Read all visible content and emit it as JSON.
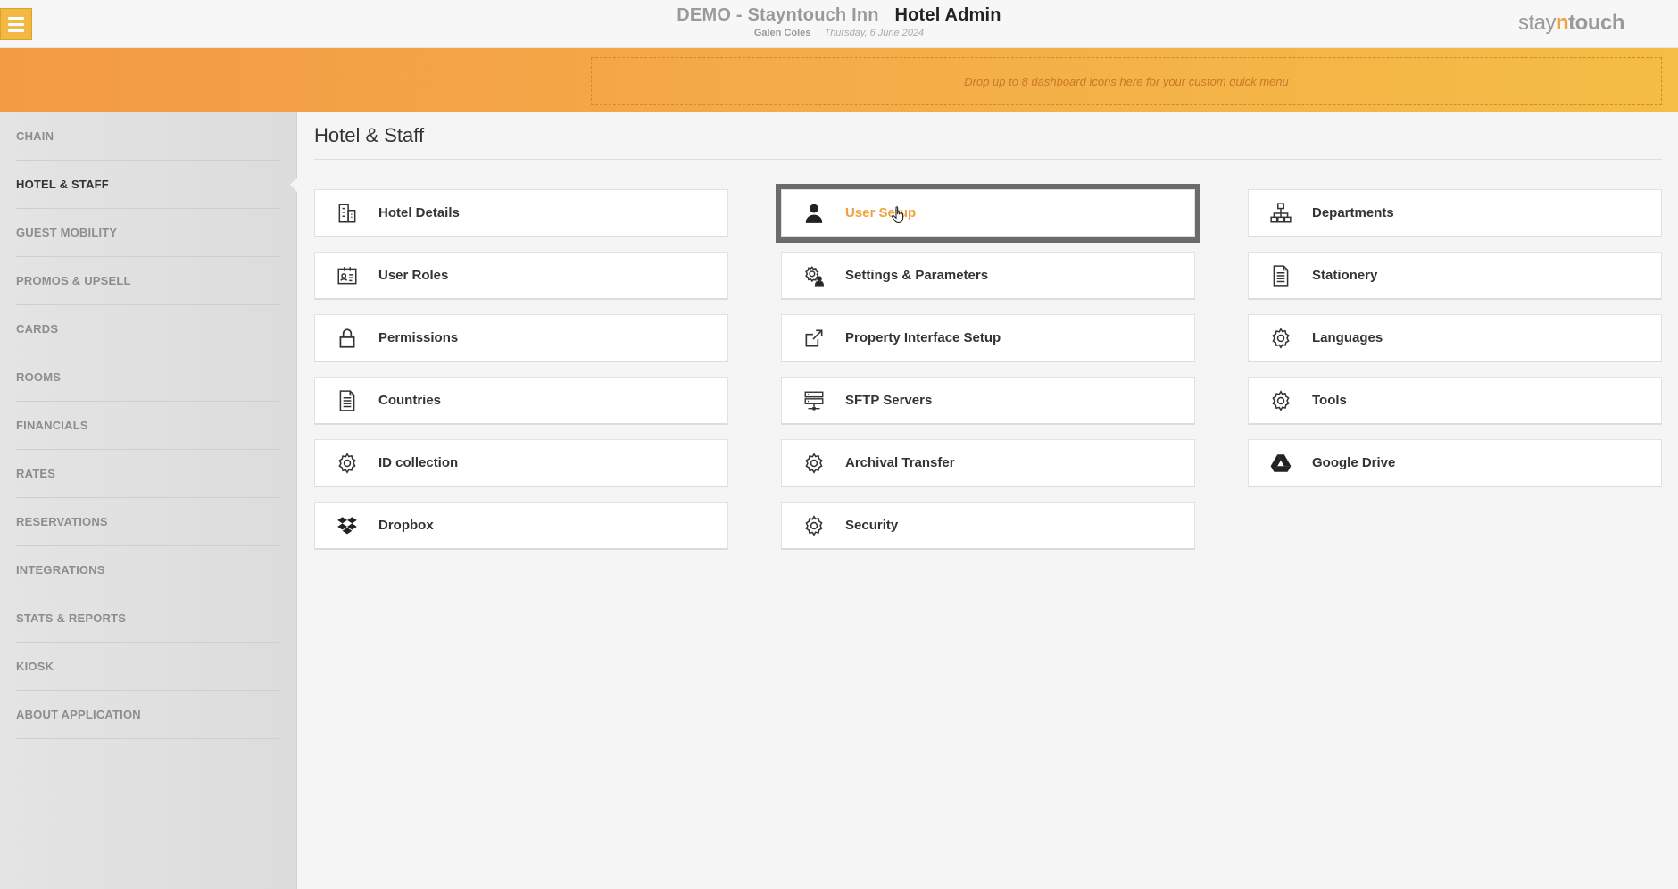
{
  "header": {
    "hotel_name": "DEMO - Stayntouch Inn",
    "app_title": "Hotel Admin",
    "user_name": "Galen Coles",
    "date": "Thursday, 6 June 2024",
    "brand_stay": "stay",
    "brand_n": "n",
    "brand_touch": "touch"
  },
  "quick_menu": {
    "placeholder": "Drop up to 8 dashboard icons here for your custom quick menu"
  },
  "sidebar": {
    "items": [
      {
        "label": "CHAIN"
      },
      {
        "label": "HOTEL & STAFF"
      },
      {
        "label": "GUEST MOBILITY"
      },
      {
        "label": "PROMOS & UPSELL"
      },
      {
        "label": "CARDS"
      },
      {
        "label": "ROOMS"
      },
      {
        "label": "FINANCIALS"
      },
      {
        "label": "RATES"
      },
      {
        "label": "RESERVATIONS"
      },
      {
        "label": "INTEGRATIONS"
      },
      {
        "label": "STATS & REPORTS"
      },
      {
        "label": "KIOSK"
      },
      {
        "label": "ABOUT APPLICATION"
      }
    ],
    "active": "HOTEL & STAFF"
  },
  "main": {
    "title": "Hotel & Staff",
    "tiles": [
      {
        "label": "Hotel Details",
        "icon": "building-icon"
      },
      {
        "label": "User Setup",
        "icon": "user-icon"
      },
      {
        "label": "Departments",
        "icon": "org-chart-icon"
      },
      {
        "label": "User Roles",
        "icon": "id-card-icon"
      },
      {
        "label": "Settings & Parameters",
        "icon": "user-gear-icon"
      },
      {
        "label": "Stationery",
        "icon": "document-icon"
      },
      {
        "label": "Permissions",
        "icon": "lock-icon"
      },
      {
        "label": "Property Interface Setup",
        "icon": "external-link-icon"
      },
      {
        "label": "Languages",
        "icon": "gear-icon"
      },
      {
        "label": "Countries",
        "icon": "document-icon"
      },
      {
        "label": "SFTP Servers",
        "icon": "server-icon"
      },
      {
        "label": "Tools",
        "icon": "gear-icon"
      },
      {
        "label": "ID collection",
        "icon": "gear-icon"
      },
      {
        "label": "Archival Transfer",
        "icon": "gear-icon"
      },
      {
        "label": "Google Drive",
        "icon": "google-drive-icon"
      },
      {
        "label": "Dropbox",
        "icon": "dropbox-icon"
      },
      {
        "label": "Security",
        "icon": "gear-icon"
      }
    ],
    "selected": "User Setup"
  },
  "colors": {
    "accent": "#f4b942",
    "band_start": "#f39a45",
    "band_end": "#f4bd45",
    "selected_text": "#f0a23a"
  }
}
